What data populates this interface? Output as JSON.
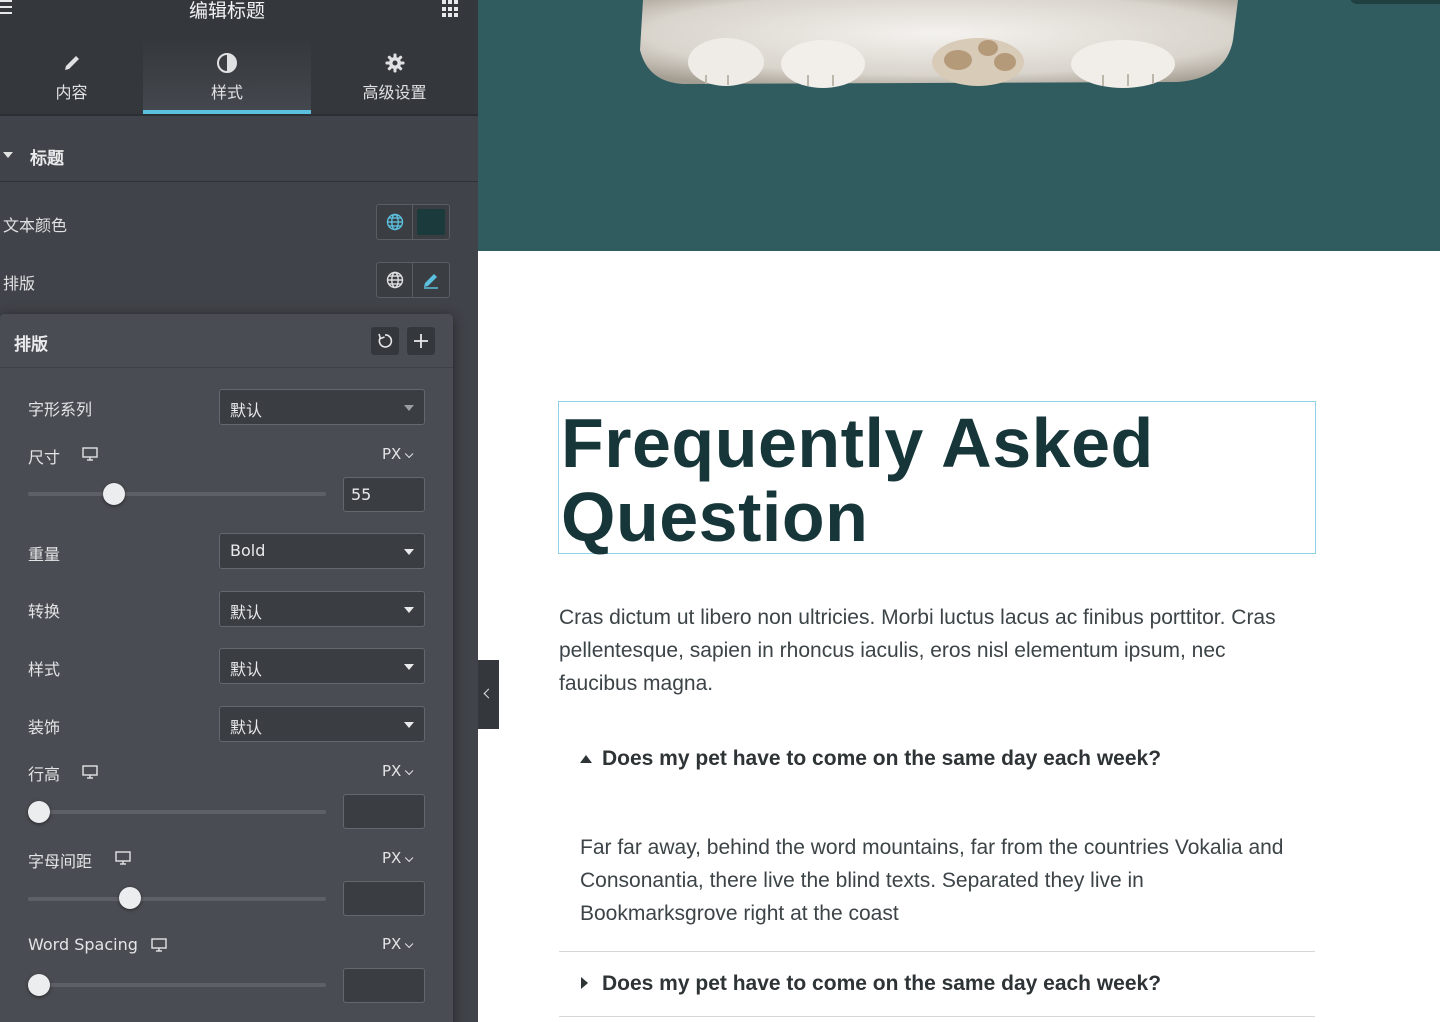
{
  "panel": {
    "title": "编辑标题",
    "tabs": [
      {
        "label": "内容",
        "icon": "pencil-icon"
      },
      {
        "label": "样式",
        "icon": "contrast-icon",
        "active": true
      },
      {
        "label": "高级设置",
        "icon": "gear-icon"
      }
    ],
    "section_title": "标题",
    "text_color_label": "文本颜色",
    "text_color_value": "#1b3a3c",
    "typography_label": "排版",
    "typography_popover": {
      "title": "排版",
      "font_family": {
        "label": "字形系列",
        "value": "默认"
      },
      "size": {
        "label": "尺寸",
        "unit": "PX",
        "value": "55",
        "slider_fraction": 0.27
      },
      "weight": {
        "label": "重量",
        "value": "Bold"
      },
      "transform": {
        "label": "转换",
        "value": "默认"
      },
      "style": {
        "label": "样式",
        "value": "默认"
      },
      "decoration": {
        "label": "装饰",
        "value": "默认"
      },
      "line_height": {
        "label": "行高",
        "unit": "PX",
        "value": "",
        "slider_fraction": 0.0
      },
      "letter_spacing": {
        "label": "字母间距",
        "unit": "PX",
        "value": "",
        "slider_fraction": 0.33
      },
      "word_spacing": {
        "label": "Word Spacing",
        "unit": "PX",
        "value": "",
        "slider_fraction": 0.0
      }
    }
  },
  "preview": {
    "hero_color": "#305c5f",
    "heading": "Frequently Asked Question",
    "heading_color": "#17363a",
    "intro": "Cras dictum ut libero non ultricies. Morbi luctus lacus ac finibus porttitor. Cras pellentesque, sapien in rhoncus iaculis, eros nisl elementum ipsum, nec faucibus magna.",
    "faq": [
      {
        "question": "Does my pet have to come on the same day each week?",
        "expanded": true,
        "answer": "Far far away, behind the word mountains, far from the countries Vokalia and Consonantia, there live the blind texts. Separated they live in Bookmarksgrove right at the coast"
      },
      {
        "question": "Does my pet have to come on the same day each week?",
        "expanded": false
      }
    ]
  },
  "accent_color": "#5bc0de"
}
